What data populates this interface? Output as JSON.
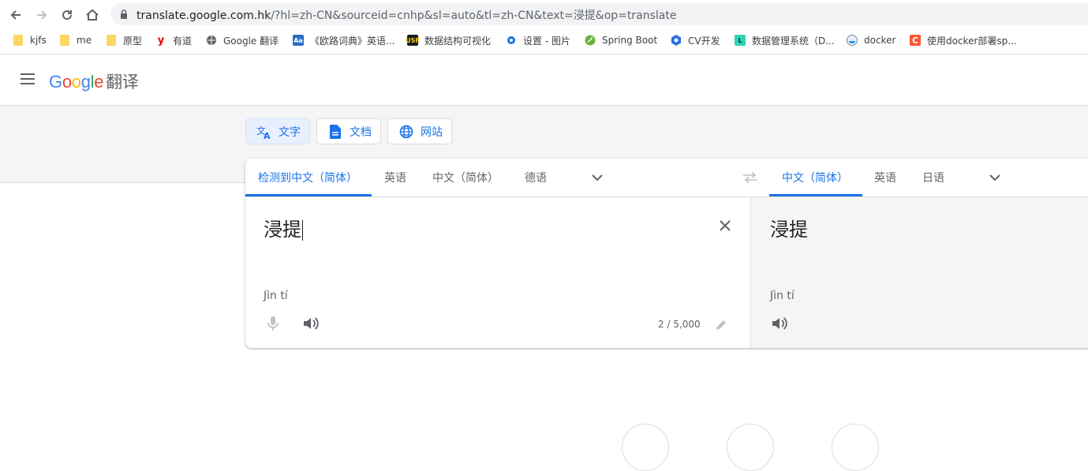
{
  "browser": {
    "url_host": "translate.google.com.hk",
    "url_path": "/?hl=zh-CN&sourceid=cnhp&sl=auto&tl=zh-CN&text=浸提&op=translate",
    "bookmarks": [
      {
        "label": "kjfs",
        "icon": "folder-icon"
      },
      {
        "label": "me",
        "icon": "folder-icon"
      },
      {
        "label": "原型",
        "icon": "folder-icon"
      },
      {
        "label": "有道",
        "icon": "youdao-icon"
      },
      {
        "label": "Google 翻译",
        "icon": "globe-icon"
      },
      {
        "label": "《欧路词典》英语...",
        "icon": "eudic-icon"
      },
      {
        "label": "数据结构可视化",
        "icon": "usf-icon"
      },
      {
        "label": "设置 - 图片",
        "icon": "gear-icon"
      },
      {
        "label": "Spring Boot",
        "icon": "spring-icon"
      },
      {
        "label": "CV开发",
        "icon": "cv-icon"
      },
      {
        "label": "数据管理系统（D...",
        "icon": "l-icon"
      },
      {
        "label": "docker",
        "icon": "docker-icon"
      },
      {
        "label": "使用docker部署sp...",
        "icon": "csdn-icon"
      }
    ],
    "colors": {
      "omnibox_bg": "#f1f3f4",
      "folder": "#fdd663"
    }
  },
  "app": {
    "logo": {
      "letters": [
        "G",
        "o",
        "o",
        "g",
        "l",
        "e"
      ],
      "product": "翻译"
    },
    "modes": [
      {
        "label": "文字",
        "icon": "translate-icon",
        "active": true
      },
      {
        "label": "文档",
        "icon": "document-icon",
        "active": false
      },
      {
        "label": "网站",
        "icon": "globe-icon",
        "active": false
      }
    ],
    "source_langs": [
      "检测到中文（简体）",
      "英语",
      "中文（简体）",
      "德语"
    ],
    "target_langs": [
      "中文（简体）",
      "英语",
      "日语"
    ],
    "source": {
      "text": "浸提",
      "pinyin": "Jìn tí",
      "char_count": "2 / 5,000"
    },
    "target": {
      "text": "浸提",
      "pinyin": "Jìn tí"
    },
    "colors": {
      "accent": "#1a73e8",
      "band": "#f5f5f5",
      "divider": "#dadce0"
    }
  }
}
